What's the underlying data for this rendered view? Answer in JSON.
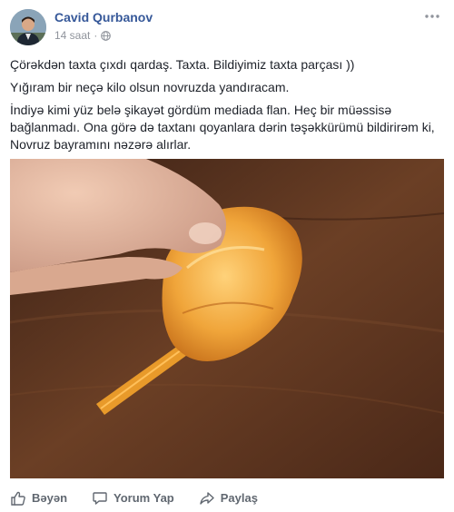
{
  "post": {
    "author": "Cavid Qurbanov",
    "time": "14 saat",
    "separator": "·",
    "paragraphs": [
      "Çörəkdən taxta çıxdı qardaş. Taxta. Bildiyimiz taxta parçası ))",
      "Yığıram bir neçə kilo olsun novruzda yandıracam.",
      "İndiyə kimi yüz belə şikayət gördüm mediada flan. Heç bir müəssisə bağlanmadı. Ona görə də taxtanı qoyanlara dərin təşəkkürümü bildirirəm ki, Novruz bayramını nəzərə alırlar."
    ]
  },
  "actions": {
    "like": "Bəyən",
    "comment": "Yorum Yap",
    "share": "Paylaş"
  },
  "colors": {
    "author": "#365899",
    "meta": "#90949c",
    "action": "#606770",
    "table": "#5a3420"
  }
}
